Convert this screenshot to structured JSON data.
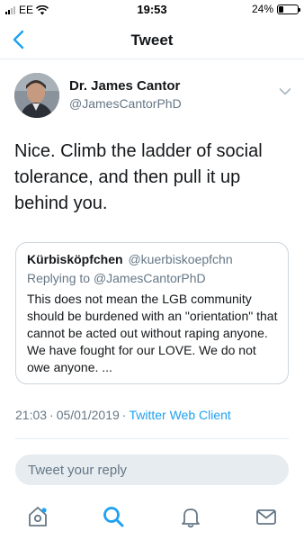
{
  "status_bar": {
    "carrier": "EE",
    "time": "19:53",
    "battery_percent_text": "24%",
    "battery_level": 0.24
  },
  "nav": {
    "title": "Tweet",
    "back_icon": "chevron-left-icon"
  },
  "tweet": {
    "author_name": "Dr. James Cantor",
    "author_handle": "@JamesCantorPhD",
    "text": "Nice.  Climb the ladder of social tolerance, and then pull it up behind you.",
    "quoted": {
      "name": "Kürbisköpfchen",
      "handle": "@kuerbiskoepfchn",
      "replying_label": "Replying to",
      "replying_to": "@JamesCantorPhD",
      "text": "This does not mean the LGB community should be burdened with an \"orientation\" that cannot be acted out without raping anyone. We have fought for our LOVE. We do not owe anyone. ..."
    },
    "time": "21:03",
    "date": "05/01/2019",
    "separator": "·",
    "client": "Twitter Web Client"
  },
  "reply": {
    "placeholder": "Tweet your reply"
  },
  "tab_bar": {
    "items": [
      {
        "icon": "home-icon"
      },
      {
        "icon": "search-icon"
      },
      {
        "icon": "notifications-icon"
      },
      {
        "icon": "messages-icon"
      }
    ]
  },
  "colors": {
    "accent": "#1da1f2",
    "text_primary": "#14171a",
    "text_secondary": "#657786",
    "border": "#ccd6dd",
    "reply_bg": "#e6ecf0"
  }
}
